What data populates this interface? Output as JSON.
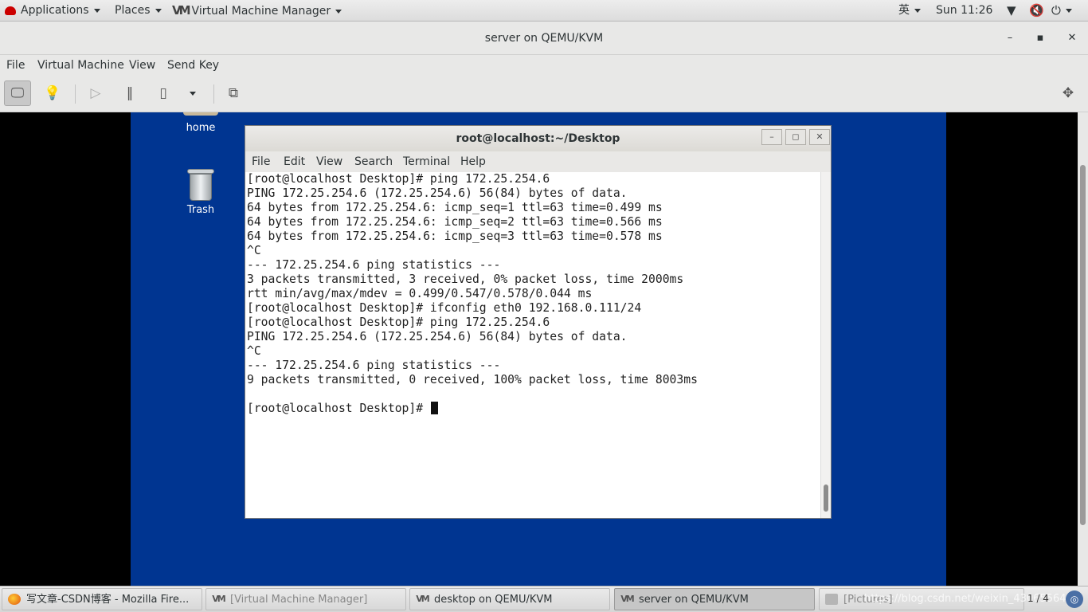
{
  "topbar": {
    "applications": "Applications",
    "places": "Places",
    "current_app": "Virtual Machine Manager",
    "input_method": "英",
    "clock": "Sun 11:26"
  },
  "viewer": {
    "title": "server on QEMU/KVM",
    "menu": [
      "File",
      "Virtual Machine",
      "View",
      "Send Key"
    ]
  },
  "desktop": {
    "icons": [
      {
        "label": "home",
        "icon": "folder-icon"
      },
      {
        "label": "Trash",
        "icon": "trash-icon"
      }
    ]
  },
  "terminal": {
    "title": "root@localhost:~/Desktop",
    "menu": [
      "File",
      "Edit",
      "View",
      "Search",
      "Terminal",
      "Help"
    ],
    "lines": [
      "[root@localhost Desktop]# ping 172.25.254.6",
      "PING 172.25.254.6 (172.25.254.6) 56(84) bytes of data.",
      "64 bytes from 172.25.254.6: icmp_seq=1 ttl=63 time=0.499 ms",
      "64 bytes from 172.25.254.6: icmp_seq=2 ttl=63 time=0.566 ms",
      "64 bytes from 172.25.254.6: icmp_seq=3 ttl=63 time=0.578 ms",
      "^C",
      "--- 172.25.254.6 ping statistics ---",
      "3 packets transmitted, 3 received, 0% packet loss, time 2000ms",
      "rtt min/avg/max/mdev = 0.499/0.547/0.578/0.044 ms",
      "[root@localhost Desktop]# ifconfig eth0 192.168.0.111/24",
      "[root@localhost Desktop]# ping 172.25.254.6",
      "PING 172.25.254.6 (172.25.254.6) 56(84) bytes of data.",
      "^C",
      "--- 172.25.254.6 ping statistics ---",
      "9 packets transmitted, 0 received, 100% packet loss, time 8003ms",
      ""
    ],
    "prompt": "[root@localhost Desktop]# "
  },
  "taskbar": {
    "tasks": [
      {
        "label": "写文章-CSDN博客 - Mozilla Fire...",
        "icon": "firefox-icon"
      },
      {
        "label": "[Virtual Machine Manager]",
        "icon": "vmm-icon"
      },
      {
        "label": "desktop on QEMU/KVM",
        "icon": "vmm-icon"
      },
      {
        "label": "server on QEMU/KVM",
        "icon": "vmm-icon"
      },
      {
        "label": "[Pictures]",
        "icon": "folder-icon"
      }
    ],
    "page_indicator": "1 / 4",
    "watermark": "https://blog.csdn.net/weixin_43065564"
  }
}
